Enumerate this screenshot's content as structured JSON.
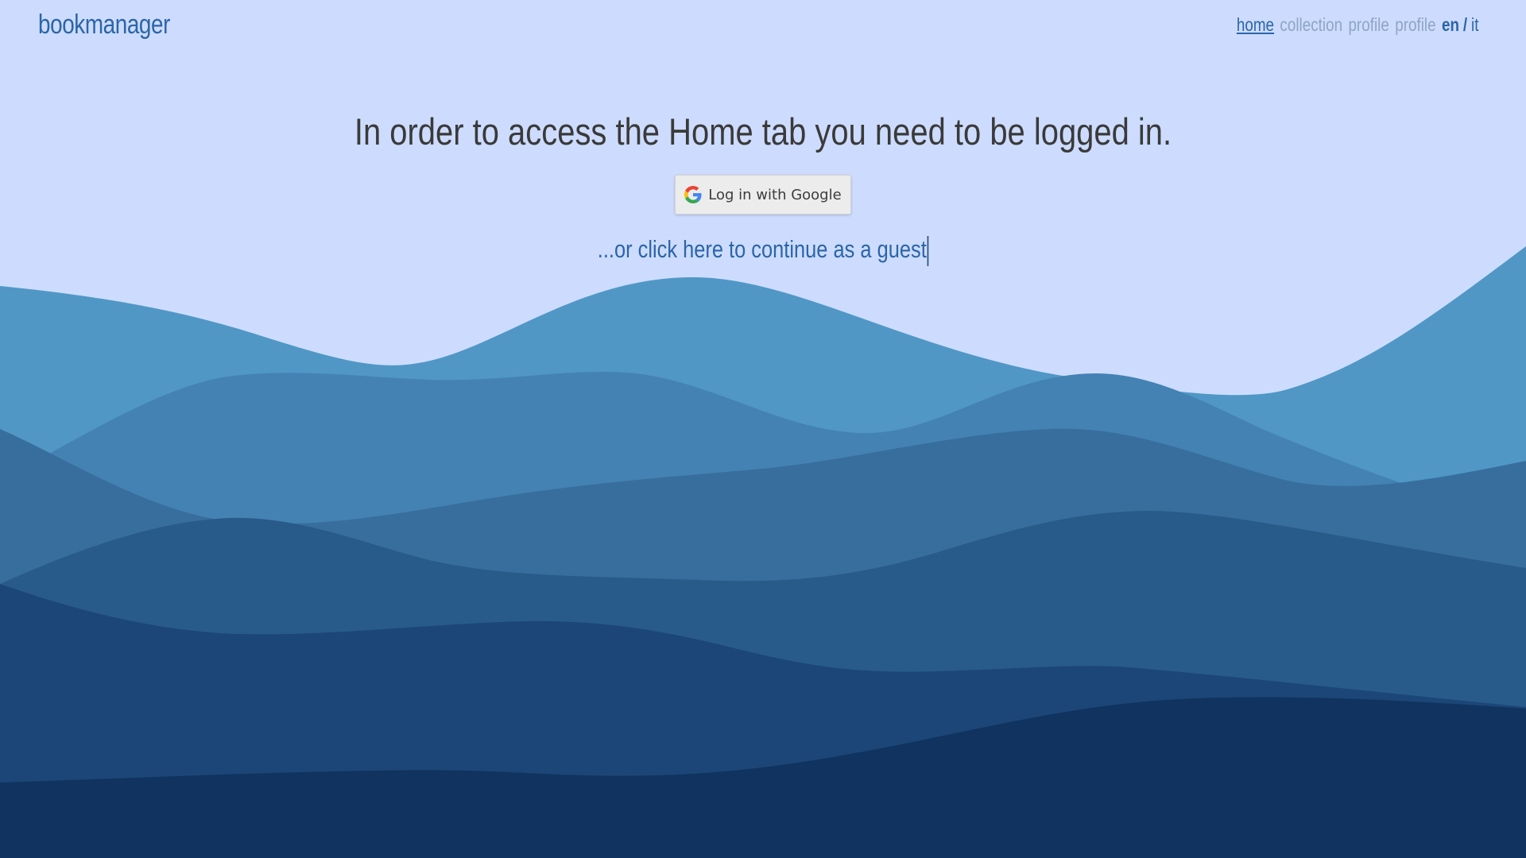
{
  "brand": {
    "name": "bookmanager"
  },
  "nav": {
    "home": "home",
    "collection": "collection",
    "profile_1": "profile",
    "profile_2": "profile",
    "lang_en": "en",
    "lang_separator": "/",
    "lang_it": "it"
  },
  "main": {
    "heading": "In order to access the Home tab you need to be logged in.",
    "google_button_label": "Log in with Google",
    "guest_link": "...or click here to continue as a guest"
  },
  "colors": {
    "background": "#cddcfe",
    "accent": "#2b65a8",
    "disabled_nav": "#8ea5c4",
    "wave_1": "#5097c6",
    "wave_2": "#4482b4",
    "wave_3": "#386e9d",
    "wave_4": "#285b8a",
    "wave_5": "#1c4677",
    "wave_6": "#10335f"
  },
  "icons": {
    "google": "google-g-logo-icon"
  }
}
